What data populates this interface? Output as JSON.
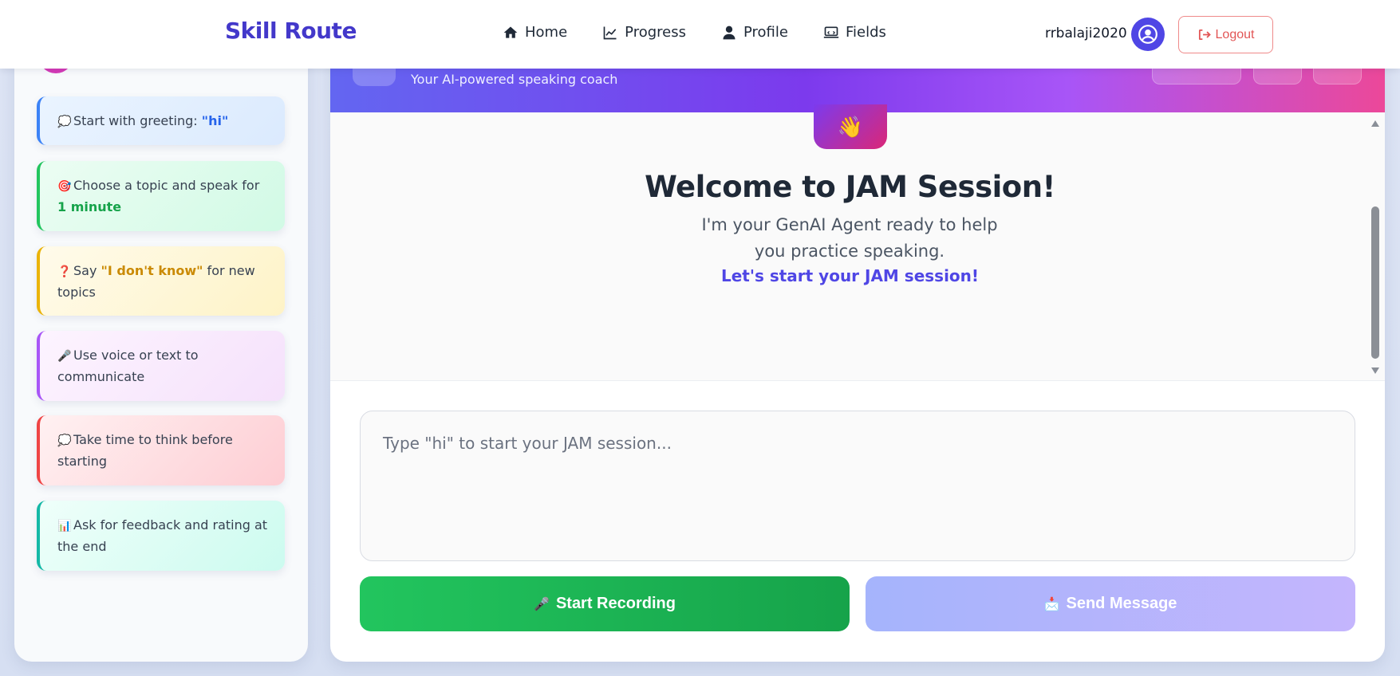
{
  "navbar": {
    "brand": "Skill Route",
    "links": [
      {
        "label": "Home",
        "icon": "home-icon"
      },
      {
        "label": "Progress",
        "icon": "chart-line-icon"
      },
      {
        "label": "Profile",
        "icon": "user-icon"
      },
      {
        "label": "Fields",
        "icon": "laptop-icon"
      }
    ],
    "username": "rrbalaji2020",
    "avatar_icon": "user-circle-icon",
    "logout_label": "Logout",
    "logout_icon": "sign-out-icon"
  },
  "sidebar": {
    "tips": [
      {
        "emoji": "💭",
        "text": "Start with greeting: ",
        "highlight": "\"hi\"",
        "after": ""
      },
      {
        "emoji": "🎯",
        "text": "Choose a topic and speak for ",
        "highlight": "1 minute",
        "after": ""
      },
      {
        "emoji": "❓",
        "text": "Say ",
        "highlight": "\"I don't know\"",
        "after": " for new topics"
      },
      {
        "emoji": "🎤",
        "text": "Use voice or text to communicate",
        "highlight": "",
        "after": ""
      },
      {
        "emoji": "💭",
        "text": "Take time to think before starting",
        "highlight": "",
        "after": ""
      },
      {
        "emoji": "📊",
        "text": "Ask for feedback and rating at the end",
        "highlight": "",
        "after": ""
      }
    ]
  },
  "chat": {
    "header_subtitle": "Your AI-powered speaking coach",
    "welcome_emoji": "👋",
    "welcome_title": "Welcome to JAM Session!",
    "welcome_text": "I'm your GenAI Agent ready to help you practice speaking.",
    "welcome_cta": "Let's start your JAM session!",
    "input_placeholder": "Type \"hi\" to start your JAM session...",
    "record_emoji": "🎤",
    "record_label": "Start Recording",
    "send_emoji": "📩",
    "send_label": "Send Message"
  },
  "colors": {
    "brand": "#4338ca",
    "header_gradient_start": "#6366f1",
    "header_gradient_end": "#ec4899",
    "record_button": "#22c55e",
    "send_button": "#a5b4fc"
  }
}
